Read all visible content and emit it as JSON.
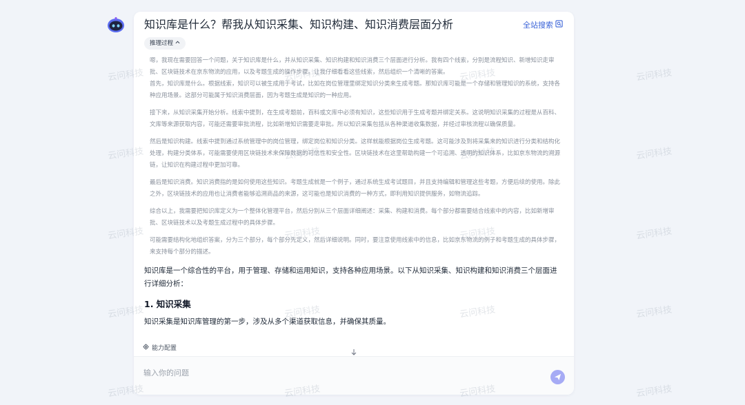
{
  "header": {
    "question": "知识库是什么？帮我从知识采集、知识构建、知识消费层面分析",
    "search_label": "全站搜索"
  },
  "reasoning": {
    "toggle_label": "推理过程",
    "paragraphs": [
      "嗯，我现在需要回答一个问题，关于知识库是什么，并从知识采集、知识构建和知识消费三个层面进行分析。我有四个线索，分别是流程知识、新增知识走审批、区块链技术在京东物流的应用，以及考题生成的操作步骤。让我仔细看看这些线索，然后组织一个清晰的答案。",
      "首先，知识库是什么。根据线索，知识可以被生成用于考试，比如在岗位管理里绑定知识分类来生成考题。那知识库可能是一个存储和管理知识的系统，支持各种应用场景。这部分可能属于知识消费层面，因为考题生成是知识的一种应用。",
      "接下来，从知识采集开始分析。线索中提到，在生成考题前，百科或文库中必须有知识，这些知识用于生成考题并绑定关系。这说明知识采集的过程是从百科、文库等来源获取内容，可能还需要审批流程，比如新增知识需要走审批。所以知识采集包括从各种渠道收集数据，并经过审核流程以确保质量。",
      "然后是知识构建。线索中提到通过系统管理中的岗位管理，绑定岗位和知识分类。这样就能根据岗位生成考题。这可能涉及到将采集来的知识进行分类和结构化处理，构建分类体系，可能需要使用区块链技术来保障数据的可信性和安全性。区块链技术在这里帮助构建一个可追溯、透明的知识体系，比如京东物流的溯源链，让知识在构建过程中更加可靠。",
      "最后是知识消费。知识消费指的是如何使用这些知识。考题生成就是一个例子，通过系统生成考试题目，并且支持编辑和管理这些考题，方便后续的使用。除此之外，区块链技术的应用也让消费者能够追溯商品的来源，这可能也是知识消费的一种方式，即利用知识提供服务，如物流追踪。",
      "综合以上，我需要把知识库定义为一个整体化管理平台，然后分别从三个层面详细阐述：采集、构建和消费。每个部分都需要结合线索中的内容，比如新增审批、区块链技术以及考题生成过程中的具体步骤。",
      "可能需要结构化地组织答案，分为三个部分，每个部分先定义，然后详细说明。同时，要注意使用线索中的信息，比如京东物流的例子和考题生成的具体步骤，来支持每个部分的描述。"
    ]
  },
  "answer": {
    "intro": "知识库是一个综合性的平台，用于管理、存储和运用知识，支持各种应用场景。以下从知识采集、知识构建和知识消费三个层面进行详细分析：",
    "section1_title": "1. 知识采集",
    "section1_text": "知识采集是知识库管理的第一步，涉及从多个渠道获取信息，并确保其质量。"
  },
  "footer": {
    "capability_label": "能力配置",
    "input_placeholder": "输入你的问题"
  },
  "watermark": {
    "text": "云问科技"
  },
  "colors": {
    "accent_blue": "#3b64d8",
    "send_button": "#a6abf5",
    "page_bg": "#f1f4f9"
  },
  "icons": {
    "avatar": "robot-avatar-icon",
    "search": "external-search-icon",
    "toggle": "chevron-up-icon",
    "capability": "gear-icon",
    "scroll": "arrow-down-icon",
    "send": "send-icon"
  }
}
